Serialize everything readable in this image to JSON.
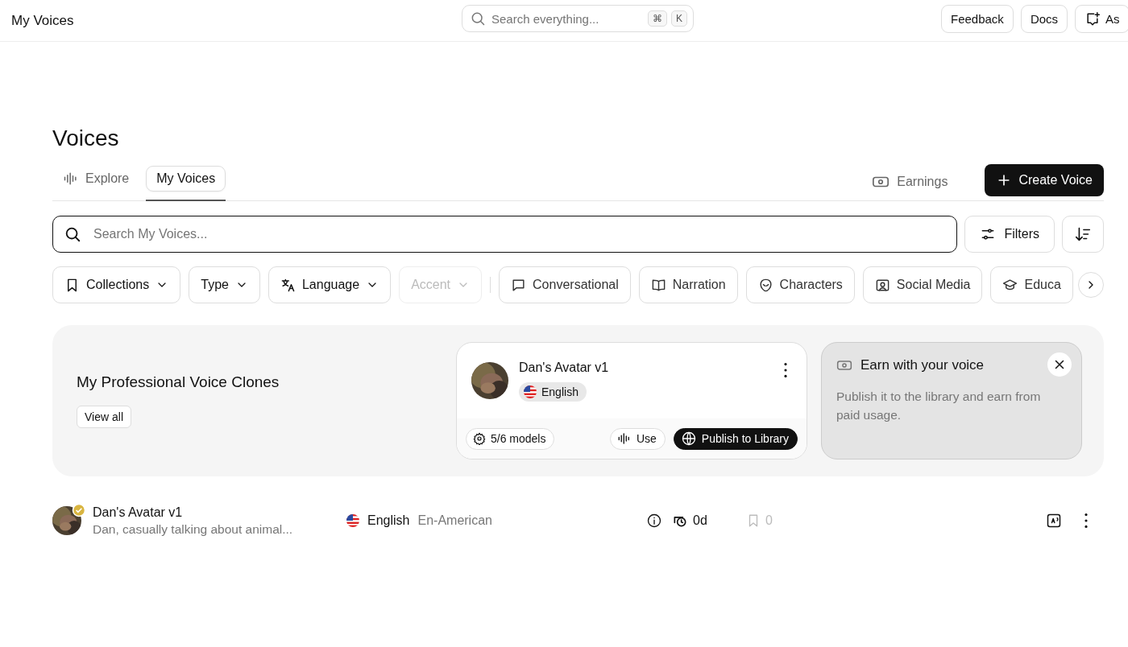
{
  "topbar": {
    "title": "My Voices",
    "search": {
      "placeholder": "Search everything...",
      "keys": [
        "⌘",
        "K"
      ]
    },
    "buttons": [
      {
        "label": "Feedback",
        "kind": "plain"
      },
      {
        "label": "Docs",
        "kind": "plain"
      },
      {
        "label": "As",
        "kind": "ask"
      }
    ]
  },
  "page": {
    "title": "Voices"
  },
  "tabs": [
    {
      "label": "Explore",
      "selected": false
    },
    {
      "label": "My Voices",
      "selected": true
    }
  ],
  "earnings": "Earnings",
  "create_button": "Create Voice",
  "search": {
    "placeholder": "Search My Voices..."
  },
  "filters_button": "Filters",
  "chips": [
    {
      "label": "Collections",
      "kind": "dropdown",
      "disabled": false
    },
    {
      "label": "Type",
      "kind": "dropdown",
      "disabled": false
    },
    {
      "label": "Language",
      "kind": "dropdown",
      "disabled": false
    },
    {
      "label": "Accent",
      "kind": "dropdown",
      "disabled": true
    },
    {
      "label": "Conversational",
      "kind": "category",
      "disabled": false
    },
    {
      "label": "Narration",
      "kind": "category",
      "disabled": false
    },
    {
      "label": "Characters",
      "kind": "category",
      "disabled": false
    },
    {
      "label": "Social Media",
      "kind": "category",
      "disabled": false
    },
    {
      "label": "Educa",
      "kind": "category",
      "disabled": false
    }
  ],
  "banner": {
    "title": "My Professional Voice Clones",
    "view_all": "View all",
    "voice_card": {
      "name": "Dan's Avatar v1",
      "language": "English",
      "models": "5/6 models",
      "use": "Use",
      "publish": "Publish to Library"
    },
    "promo": {
      "title": "Earn with your voice",
      "text": "Publish it to the library and earn from paid usage."
    }
  },
  "voices": [
    {
      "name": "Dan's Avatar v1",
      "description": "Dan, casually talking about animal...",
      "verified": true,
      "language": "English",
      "accent": "En-American",
      "notice": "0d",
      "saves": "0"
    }
  ]
}
